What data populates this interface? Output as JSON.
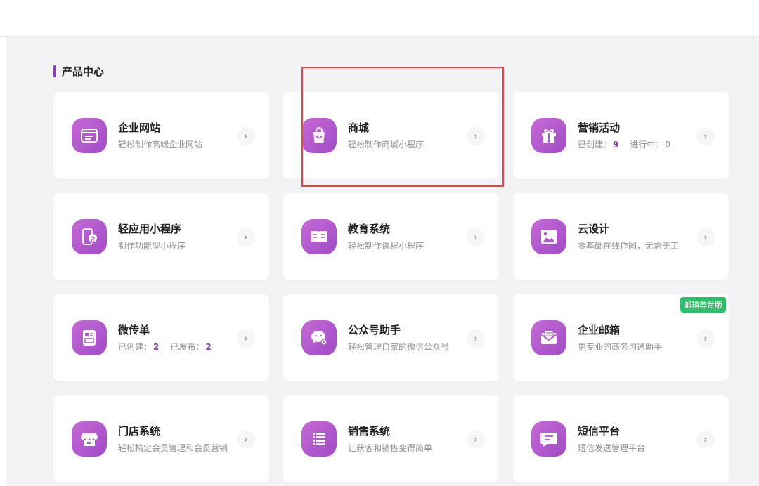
{
  "section": {
    "title": "产品中心"
  },
  "cards": [
    {
      "title": "企业网站",
      "desc": "轻松制作高端企业网站",
      "icon": "website-icon"
    },
    {
      "title": "商城",
      "desc": "轻松制作商城小程序",
      "icon": "shopping-bag-icon"
    },
    {
      "title": "营销活动",
      "stat1_label": "已创建：",
      "stat1_value": "9",
      "stat2_label": "进行中：",
      "stat2_value": "0",
      "icon": "gift-icon"
    },
    {
      "title": "轻应用小程序",
      "desc": "制作功能型小程序",
      "icon": "mini-program-icon"
    },
    {
      "title": "教育系统",
      "desc": "轻松制作课程小程序",
      "icon": "book-icon"
    },
    {
      "title": "云设计",
      "desc": "零基础在线作图，无需美工",
      "icon": "image-icon"
    },
    {
      "title": "微传单",
      "stat1_label": "已创建：",
      "stat1_value": "2",
      "stat2_label": "已发布：",
      "stat2_value": "2",
      "icon": "flyer-icon"
    },
    {
      "title": "公众号助手",
      "desc": "轻松管理自家的微信公众号",
      "icon": "wechat-icon"
    },
    {
      "title": "企业邮箱",
      "desc": "更专业的商务沟通助手",
      "badge": "邮箱尊贵版",
      "icon": "mail-icon"
    },
    {
      "title": "门店系统",
      "desc": "轻松搞定会员管理和会员营销",
      "icon": "store-icon"
    },
    {
      "title": "销售系统",
      "desc": "让获客和销售变得简单",
      "icon": "list-icon"
    },
    {
      "title": "短信平台",
      "desc": "短信发送管理平台",
      "icon": "message-icon"
    }
  ],
  "arrow_glyph": "›",
  "colors": {
    "accent": "#8e3fb3",
    "icon_bg": "#b05bcd",
    "badge": "#2fbd6a",
    "highlight": "#e04848"
  }
}
